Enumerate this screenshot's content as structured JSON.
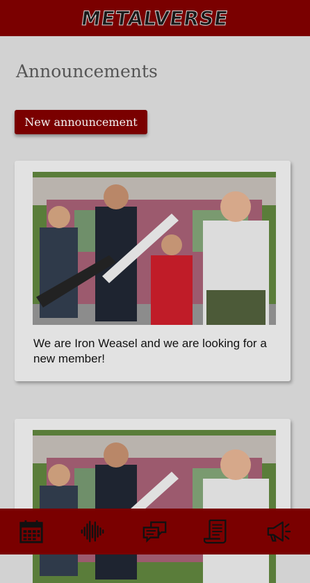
{
  "header": {
    "logo_text": "Metalverse"
  },
  "page": {
    "title": "Announcements"
  },
  "actions": {
    "new_announcement_label": "New announcement"
  },
  "announcements": [
    {
      "image": "band-photo",
      "text": "We are Iron Weasel and we are looking for a new member!"
    },
    {
      "image": "band-photo",
      "text": ""
    }
  ],
  "bottom_nav": [
    {
      "icon": "calendar-icon"
    },
    {
      "icon": "sound-wave-icon"
    },
    {
      "icon": "chat-bubbles-icon"
    },
    {
      "icon": "scroll-icon"
    },
    {
      "icon": "megaphone-icon"
    }
  ],
  "colors": {
    "brand": "#7a0000",
    "background": "#d2d2d2",
    "card": "#e2e2e2",
    "title": "#555555"
  }
}
